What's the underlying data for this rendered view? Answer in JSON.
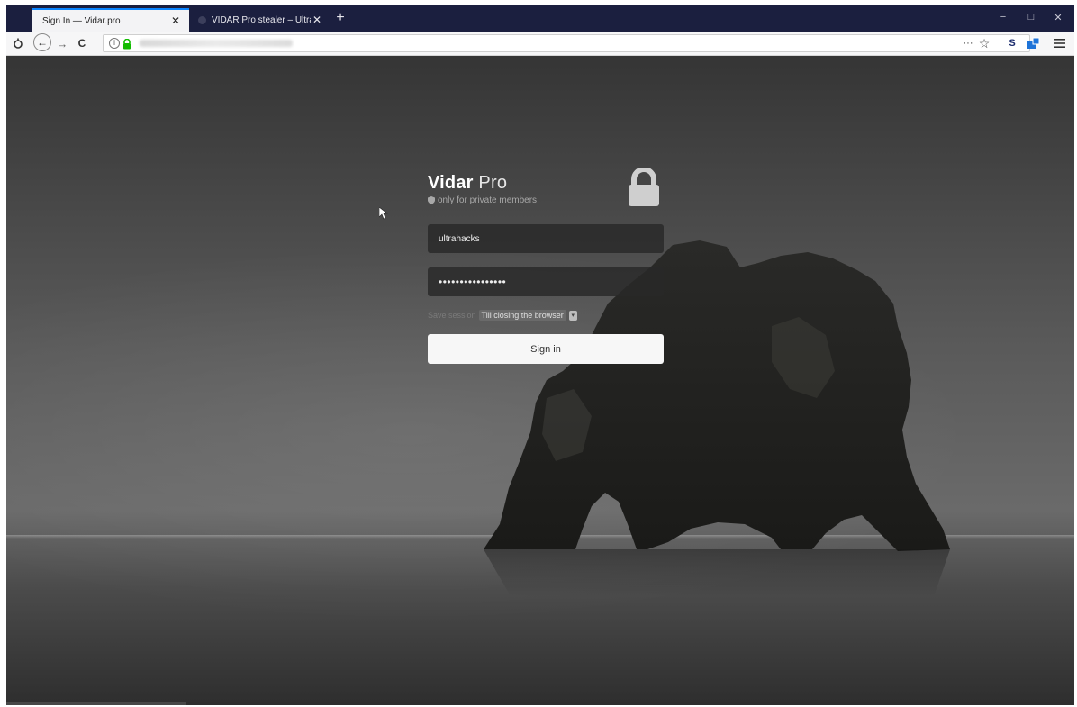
{
  "browser": {
    "tabs": [
      {
        "label": "Sign In — Vidar.pro",
        "close": "✕",
        "active": true
      },
      {
        "label": "VIDAR Pro stealer – Ultra Hacks",
        "close": "✕",
        "active": false
      }
    ],
    "new_tab": "+",
    "window_controls": {
      "minimize": "−",
      "maximize": "□",
      "close": "✕"
    },
    "nav": {
      "back": "←",
      "forward": "→",
      "reload": "C",
      "info": "i"
    },
    "toolbar_right": {
      "more": "···",
      "bookmark": "☆",
      "ext1": "S"
    }
  },
  "login": {
    "brand_bold": "Vidar",
    "brand_light": " Pro",
    "subtitle": "only for private members",
    "username": "ultrahacks",
    "password_mask": "••••••••••••••••",
    "session_label": "Save session",
    "session_value": "Till closing the browser",
    "signin_label": "Sign in"
  },
  "colors": {
    "tab_strip": "#1b1f3f",
    "accent_tab": "#0a84ff",
    "lock_green": "#12bc00"
  }
}
